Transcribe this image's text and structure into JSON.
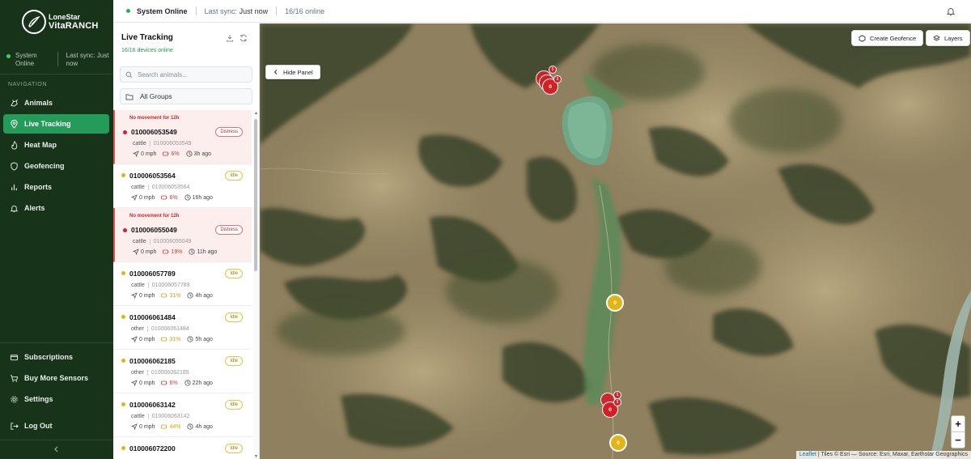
{
  "brand": {
    "top": "LoneStar",
    "bottom": "VitaRANCH"
  },
  "sidebar": {
    "status_online": "System Online",
    "last_sync": "Last sync: Just now",
    "nav_title": "NAVIGATION",
    "nav": [
      {
        "label": "Animals",
        "icon": "paw-icon"
      },
      {
        "label": "Live Tracking",
        "icon": "location-pin-icon",
        "active": true
      },
      {
        "label": "Heat Map",
        "icon": "flame-icon"
      },
      {
        "label": "Geofencing",
        "icon": "shield-icon"
      },
      {
        "label": "Reports",
        "icon": "bar-chart-icon"
      },
      {
        "label": "Alerts",
        "icon": "bell-icon"
      }
    ],
    "bottom_nav": [
      {
        "label": "Subscriptions",
        "icon": "card-icon"
      },
      {
        "label": "Buy More Sensors",
        "icon": "cart-icon"
      },
      {
        "label": "Settings",
        "icon": "gear-icon"
      },
      {
        "label": "Log Out",
        "icon": "logout-icon"
      }
    ],
    "collapse_icon": "chevron-left-icon"
  },
  "topbar": {
    "status": "System Online",
    "sync_label": "Last sync:",
    "sync_value": "Just now",
    "online_count": "16/16 online"
  },
  "panel": {
    "title": "Live Tracking",
    "subtitle": "16/16 devices online",
    "search_placeholder": "Search animals...",
    "group_filter": "All Groups",
    "animals": [
      {
        "id": "010006053549",
        "type": "cattle",
        "tag": "010006053549",
        "speed": "0 mph",
        "battery": "6%",
        "battery_level": "low",
        "seen": "3h ago",
        "status": "Distress",
        "alert": "No movement for 12h"
      },
      {
        "id": "010006053564",
        "type": "cattle",
        "tag": "010006053564",
        "speed": "0 mph",
        "battery": "6%",
        "battery_level": "low",
        "seen": "16h ago",
        "status": "Idle",
        "alert": ""
      },
      {
        "id": "010006055049",
        "type": "cattle",
        "tag": "010006055049",
        "speed": "0 mph",
        "battery": "19%",
        "battery_level": "low",
        "seen": "11h ago",
        "status": "Distress",
        "alert": "No movement for 12h"
      },
      {
        "id": "010006057789",
        "type": "cattle",
        "tag": "010006057789",
        "speed": "0 mph",
        "battery": "31%",
        "battery_level": "mid",
        "seen": "4h ago",
        "status": "Idle",
        "alert": ""
      },
      {
        "id": "010006061484",
        "type": "other",
        "tag": "010006061484",
        "speed": "0 mph",
        "battery": "31%",
        "battery_level": "mid",
        "seen": "5h ago",
        "status": "Idle",
        "alert": ""
      },
      {
        "id": "010006062185",
        "type": "other",
        "tag": "010006062185",
        "speed": "0 mph",
        "battery": "6%",
        "battery_level": "low",
        "seen": "22h ago",
        "status": "Idle",
        "alert": ""
      },
      {
        "id": "010006063142",
        "type": "cattle",
        "tag": "010006063142",
        "speed": "0 mph",
        "battery": "44%",
        "battery_level": "mid",
        "seen": "4h ago",
        "status": "Idle",
        "alert": ""
      },
      {
        "id": "010006072200",
        "type": "cattle",
        "tag": "010006072200",
        "speed": "",
        "battery": "",
        "battery_level": "",
        "seen": "",
        "status": "Idle",
        "alert": ""
      }
    ]
  },
  "map": {
    "hide_panel": "Hide Panel",
    "create_geofence": "Create Geofence",
    "layers": "Layers",
    "zoom_in": "+",
    "zoom_out": "−",
    "attribution_link": "Leaflet",
    "attribution_text": "| Tiles © Esri — Source: Esri, Maxar, Earthstar Geographics",
    "clusters": [
      {
        "label": "0",
        "color": "#e2b417"
      },
      {
        "label": "0",
        "color": "#e2b417"
      },
      {
        "label": "0",
        "color": "#d32027"
      },
      {
        "label": "1",
        "color": "#d32027"
      },
      {
        "label": "1",
        "color": "#d32027"
      },
      {
        "label": "0",
        "color": "#d32027"
      },
      {
        "label": "1",
        "color": "#d32027"
      },
      {
        "label": "1",
        "color": "#d32027"
      }
    ]
  },
  "colors": {
    "sidebar_bg": "#173319",
    "active_nav": "#259b5a",
    "online": "#24b25c",
    "distress": "#d32027",
    "idle": "#e2b417"
  }
}
